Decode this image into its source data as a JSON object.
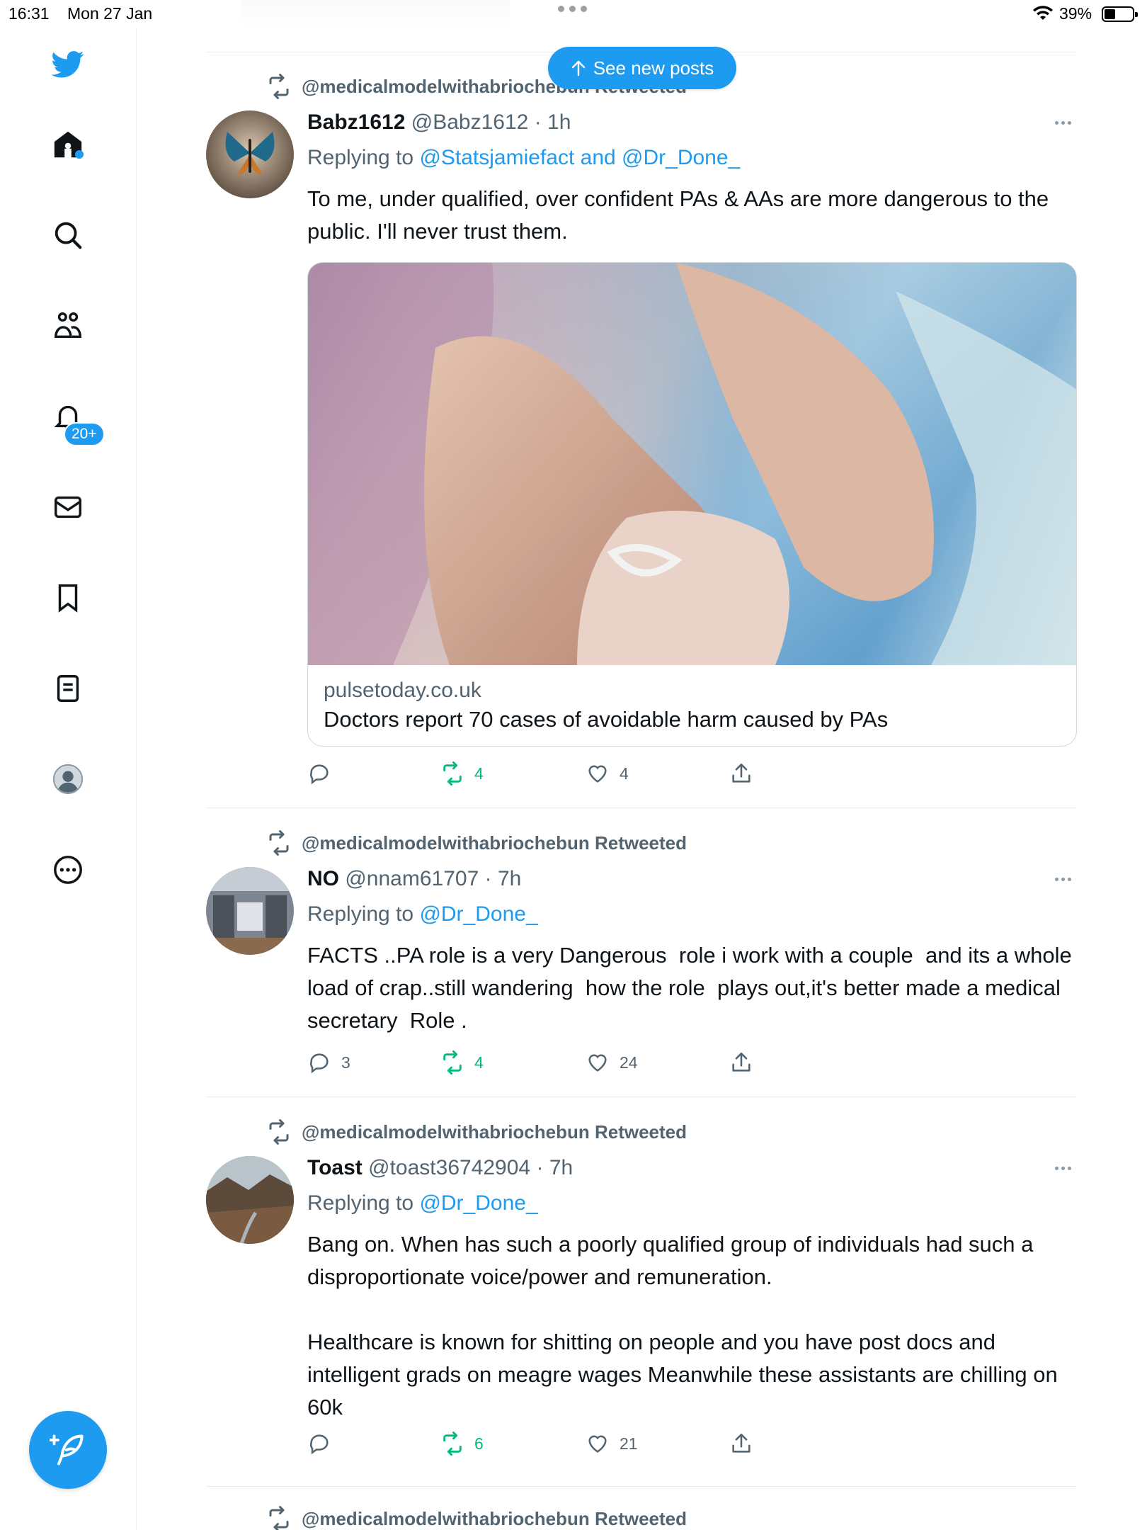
{
  "status_bar": {
    "time": "16:31",
    "date": "Mon 27 Jan",
    "battery": "39%"
  },
  "sidebar": {
    "items": [
      {
        "icon": "twitter-bird-icon"
      },
      {
        "icon": "home-icon"
      },
      {
        "icon": "search-icon"
      },
      {
        "icon": "communities-icon"
      },
      {
        "icon": "notifications-bell-icon"
      },
      {
        "icon": "messages-envelope-icon"
      },
      {
        "icon": "bookmark-icon"
      },
      {
        "icon": "lists-icon"
      },
      {
        "icon": "profile-avatar-icon"
      },
      {
        "icon": "more-circle-icon"
      }
    ],
    "notifications_badge": "20+",
    "compose_icon": "compose-feather-icon"
  },
  "feed": {
    "new_posts_label": "See new posts",
    "tweets": [
      {
        "retweeted_by": "@medicalmodelwithabriochebun Retweeted",
        "name": "Babz1612",
        "handle": "@Babz1612",
        "sep": "·",
        "time": "1h",
        "replying_prefix": "Replying to",
        "replying_to": "@Statsjamiefact and @Dr_Done_",
        "text": "To me, under qualified, over confident PAs & AAs are more dangerous to the public. I'll never trust them.",
        "card": {
          "domain": "pulsetoday.co.uk",
          "title": "Doctors report 70 cases of avoidable harm caused by PAs"
        },
        "replies": "",
        "retweets": "4",
        "likes": "4"
      },
      {
        "retweeted_by": "@medicalmodelwithabriochebun Retweeted",
        "name": "NO",
        "handle": "@nnam61707",
        "sep": "·",
        "time": "7h",
        "replying_prefix": "Replying to",
        "replying_to": "@Dr_Done_",
        "text": "FACTS ..PA role is a very Dangerous  role i work with a couple  and its a whole  load of crap..still wandering  how the role  plays out,it's better made a medical secretary  Role .",
        "replies": "3",
        "retweets": "4",
        "likes": "24"
      },
      {
        "retweeted_by": "@medicalmodelwithabriochebun Retweeted",
        "name": "Toast",
        "handle": "@toast36742904",
        "sep": "·",
        "time": "7h",
        "replying_prefix": "Replying to",
        "replying_to": "@Dr_Done_",
        "text": "Bang on. When has such a poorly qualified group of individuals had such a disproportionate voice/power and remuneration.\n\nHealthcare is known for shitting on people and you have post docs and intelligent grads on meagre wages Meanwhile these assistants are chilling on 60k",
        "replies": "",
        "retweets": "6",
        "likes": "21"
      },
      {
        "retweeted_by": "@medicalmodelwithabriochebun Retweeted"
      }
    ]
  },
  "colors": {
    "accent": "#1d9bf0",
    "retweet_green": "#00ba7c",
    "muted": "#536471"
  }
}
